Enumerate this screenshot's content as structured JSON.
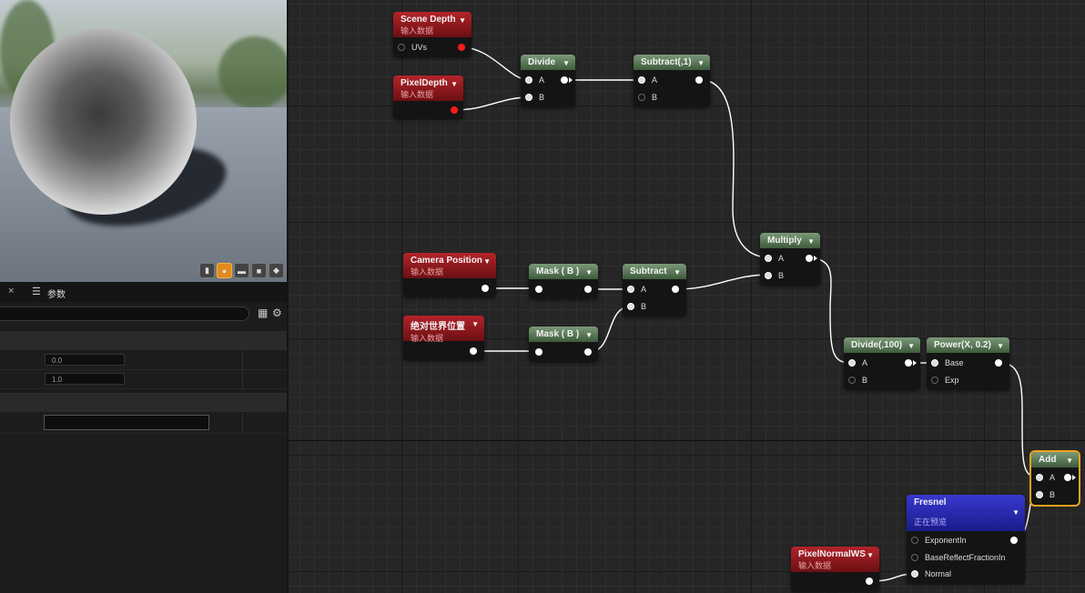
{
  "details": {
    "tab_close": "×",
    "tab_label": "参数",
    "fields": {
      "value1": "0.0",
      "value2": "1.0"
    }
  },
  "nodes": {
    "scene_depth": {
      "title": "Scene Depth",
      "subtitle": "输入数据",
      "pin_uvs": "UVs"
    },
    "pixel_depth": {
      "title": "PixelDepth",
      "subtitle": "输入数据"
    },
    "divide": {
      "title": "Divide",
      "pin_a": "A",
      "pin_b": "B"
    },
    "subtract1": {
      "title": "Subtract(,1)",
      "pin_a": "A",
      "pin_b": "B"
    },
    "camera_position": {
      "title": "Camera Position",
      "subtitle": "输入数据"
    },
    "world_position": {
      "title": "绝对世界位置",
      "subtitle": "输入数据"
    },
    "mask1": {
      "title": "Mask ( B )"
    },
    "mask2": {
      "title": "Mask ( B )"
    },
    "subtract2": {
      "title": "Subtract",
      "pin_a": "A",
      "pin_b": "B"
    },
    "multiply": {
      "title": "Multiply",
      "pin_a": "A",
      "pin_b": "B"
    },
    "divide100": {
      "title": "Divide(,100)",
      "pin_a": "A",
      "pin_b": "B"
    },
    "power": {
      "title": "Power(X, 0.2)",
      "pin_base": "Base",
      "pin_exp": "Exp"
    },
    "add": {
      "title": "Add",
      "pin_a": "A",
      "pin_b": "B"
    },
    "fresnel": {
      "title": "Fresnel",
      "subtitle": "正在预览",
      "pin1": "ExponentIn",
      "pin2": "BaseReflectFractionIn",
      "pin3": "Normal"
    },
    "pixel_normal": {
      "title": "PixelNormalWS",
      "subtitle": "输入数据"
    }
  },
  "colors": {
    "graph_bg": "#262626",
    "wire": "#ffffff",
    "selection": "#f1a21c",
    "preview_orange": "#e08a1c"
  }
}
